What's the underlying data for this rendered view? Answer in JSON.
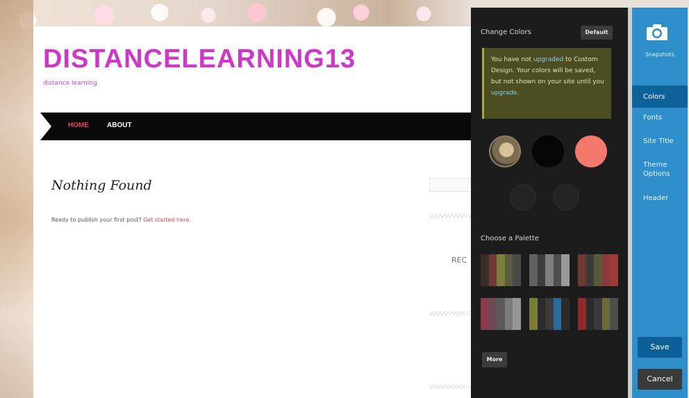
{
  "site": {
    "title": "DISTANCELEARNING13",
    "tagline": "distance learning",
    "nav": [
      {
        "label": "HOME",
        "active": true
      },
      {
        "label": "ABOUT",
        "active": false
      }
    ],
    "content": {
      "heading": "Nothing Found",
      "message": "Ready to publish your first post? ",
      "link_text": "Get started here."
    },
    "sidebar": {
      "recent_label": "REC"
    }
  },
  "colors_panel": {
    "title": "Change Colors",
    "default_button": "Default",
    "notice": {
      "text_before": "You have not ",
      "link_1": "upgraded",
      "text_middle": " to Custom Design. Your colors will be saved, but not shown on your site until you ",
      "link_2": "upgrade",
      "text_after": "."
    },
    "swatches": [
      {
        "kind": "image",
        "color": "#7c6c52"
      },
      {
        "kind": "color",
        "color": "#050505"
      },
      {
        "kind": "color",
        "color": "#f4786b"
      }
    ],
    "palette_label": "Choose a Palette",
    "palettes": [
      [
        "#3a2d2a",
        "#6b3a37",
        "#7c7e3a",
        "#5b5c3c",
        "#4a4a4a"
      ],
      [
        "#606060",
        "#3c3c3c",
        "#7f7f7f",
        "#4d4d4d",
        "#9a9a9a"
      ],
      [
        "#6b3a2f",
        "#3b3b3b",
        "#5a5a3a",
        "#8a3a3a",
        "#a03a3a"
      ],
      [
        "#8a3a4a",
        "#6b4a55",
        "#5a5a5a",
        "#7a7a7a",
        "#969696"
      ],
      [
        "#7a7a3a",
        "#2b2b2b",
        "#3a3a3a",
        "#2a6b9a",
        "#2b2b2b"
      ],
      [
        "#8a2a2a",
        "#2b2b2b",
        "#3a3a3a",
        "#6b6b3a",
        "#4d4d4d"
      ]
    ],
    "more_button": "More"
  },
  "customizer_menu": {
    "snapshots_label": "Snapshots",
    "items": [
      "Colors",
      "Fonts",
      "Site Title",
      "Theme Options",
      "Header"
    ],
    "active_item": "Colors",
    "save_label": "Save",
    "cancel_label": "Cancel"
  }
}
